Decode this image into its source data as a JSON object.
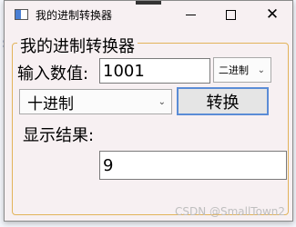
{
  "window": {
    "title": "我的进制转换器",
    "minimize_icon": "minimize-icon",
    "maximize_icon": "maximize-icon",
    "close_icon": "close-icon"
  },
  "group": {
    "legend": "我的进制转换器"
  },
  "input_label": "输入数值:",
  "input_value": "1001",
  "from_base": {
    "selected": "二进制"
  },
  "to_base": {
    "selected": "十进制"
  },
  "convert_button": "转换",
  "result_label": "显示结果:",
  "result_value": "9",
  "watermark": "CSDN @SmallTown2"
}
